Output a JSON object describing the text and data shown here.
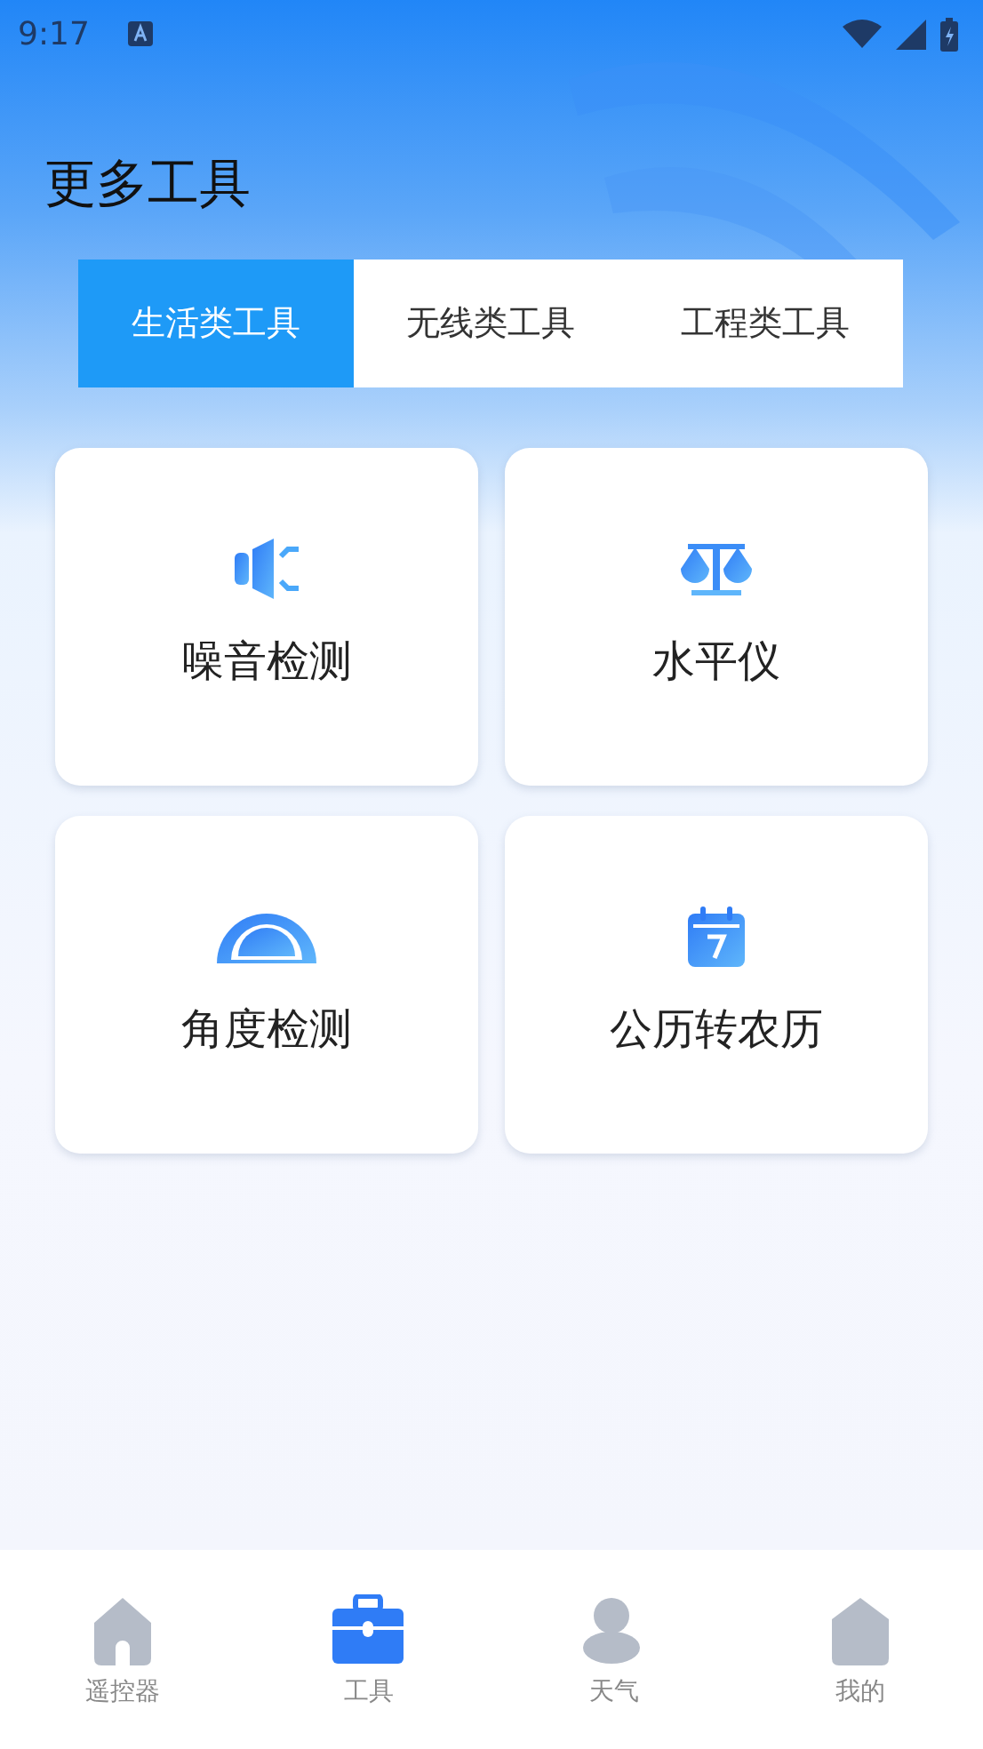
{
  "status_bar": {
    "time": "9:17"
  },
  "header": {
    "title": "更多工具"
  },
  "tabs": [
    {
      "label": "生活类工具",
      "selected": true
    },
    {
      "label": "无线类工具",
      "selected": false
    },
    {
      "label": "工程类工具",
      "selected": false
    }
  ],
  "tools": [
    {
      "label": "噪音检测",
      "kind": "speaker"
    },
    {
      "label": "水平仪",
      "kind": "scale"
    },
    {
      "label": "角度检测",
      "kind": "protractor"
    },
    {
      "label": "公历转农历",
      "kind": "calendar"
    }
  ],
  "bottom_nav": [
    {
      "label": "遥控器",
      "kind": "home",
      "selected": false
    },
    {
      "label": "工具",
      "kind": "toolbox",
      "selected": true
    },
    {
      "label": "天气",
      "kind": "weather",
      "selected": false
    },
    {
      "label": "我的",
      "kind": "profile",
      "selected": false
    }
  ]
}
